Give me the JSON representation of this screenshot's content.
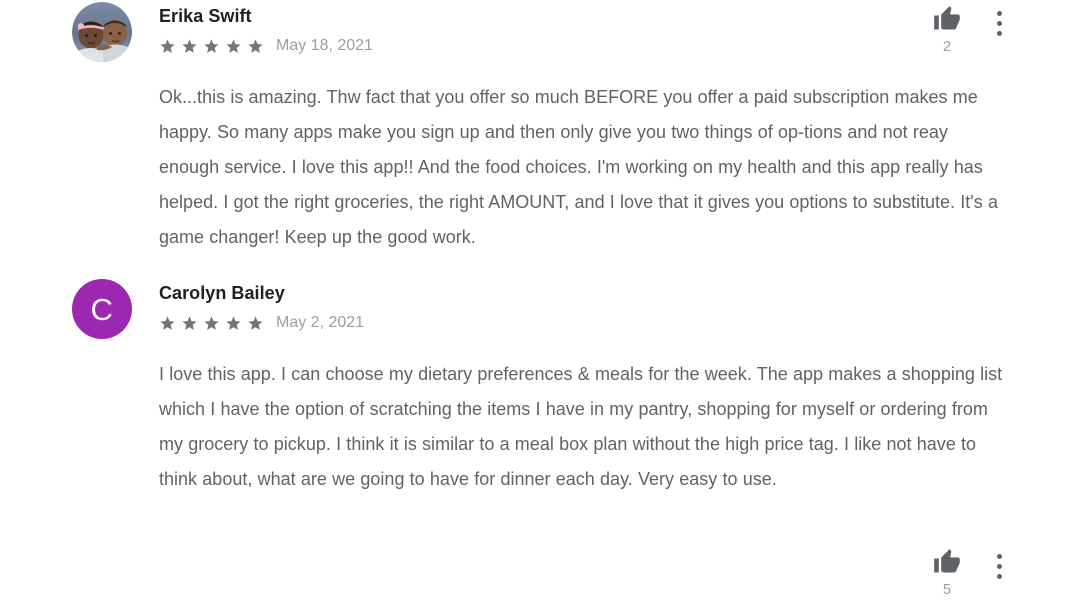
{
  "page": {
    "type": "app-review-list",
    "background": "#ffffff",
    "text_color": "#5f6368",
    "name_color": "#212121",
    "muted_color": "#9e9e9e"
  },
  "reviews": [
    {
      "reviewer_name": "Erika Swift",
      "rating": 5,
      "rating_label": "5 out of 5 stars",
      "date": "May 18, 2021",
      "body": "Ok...this is amazing. Thw fact that you offer so much BEFORE you offer a paid subscription makes me happy. So many apps make you sign up and then only give you two things of op-tions and not reay enough service. I love this app!! And the food choices. I'm working on my health and this app really has helped. I got the right groceries, the right AMOUNT, and I love that it gives you options to substitute. It's a game changer! Keep up the good work.",
      "helpful_count": "2",
      "avatar": {
        "kind": "photo",
        "description": "two-babies-photo",
        "background": "#6b7a93"
      },
      "thumb_icon": "thumb-up-icon",
      "menu_icon": "more-vert-icon"
    },
    {
      "reviewer_name": "Carolyn Bailey",
      "rating": 5,
      "rating_label": "5 out of 5 stars",
      "date": "May 2, 2021",
      "body": "I love this app. I can choose my dietary preferences & meals for the week. The app makes a shopping list which I have the option of scratching the items I have in my pantry, shopping for myself or ordering from my grocery to pickup. I think it is similar to a meal box plan without the high price tag. I like not have to think about, what are we going to have for dinner each day. Very easy to use.",
      "helpful_count": "5",
      "avatar": {
        "kind": "letter",
        "letter": "C",
        "background": "#9c27b0"
      },
      "thumb_icon": "thumb-up-icon",
      "menu_icon": "more-vert-icon"
    }
  ],
  "icons": {
    "star": "star-filled-icon",
    "star_color": "#757575",
    "thumb_up": "thumb-up-icon",
    "thumb_color": "#5f6368",
    "more_vert": "more-vert-icon"
  }
}
